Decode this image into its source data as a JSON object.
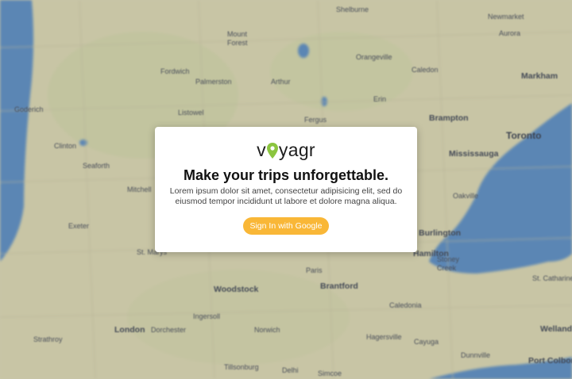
{
  "map": {
    "labels": [
      "Shelburne",
      "Newmarket",
      "Aurora",
      "Mount Forest",
      "Orangeville",
      "Caledon",
      "Markham",
      "Fordwich",
      "Palmerston",
      "Arthur",
      "Goderich",
      "Listowel",
      "Erin",
      "Brampton",
      "Toronto",
      "Fergus",
      "Clinton",
      "Mississauga",
      "Seaforth",
      "Oakville",
      "Mitchell",
      "Exeter",
      "Burlington",
      "Hamilton",
      "Stoney Creek",
      "St. Marys",
      "Paris",
      "St. Catharines",
      "Woodstock",
      "Brantford",
      "Ingersoll",
      "Caledonia",
      "Welland",
      "London",
      "Dorchester",
      "Norwich",
      "Hagersville",
      "Cayuga",
      "Strathroy",
      "Dunnville",
      "Port Colborne",
      "Tillsonburg",
      "Delhi",
      "Simcoe"
    ],
    "colors": {
      "land": "#c9c6a8",
      "water": "#5b86b4"
    }
  },
  "modal": {
    "logo_prefix": "v",
    "logo_suffix": "yagr",
    "headline": "Make your trips unforgettable.",
    "body": "Lorem ipsum dolor sit amet, consectetur adipisicing elit, sed do eiusmod tempor incididunt ut labore et dolore magna aliqua.",
    "button_label": "Sign In with Google",
    "colors": {
      "button": "#f9b737",
      "pin": "#8bc53f"
    }
  }
}
